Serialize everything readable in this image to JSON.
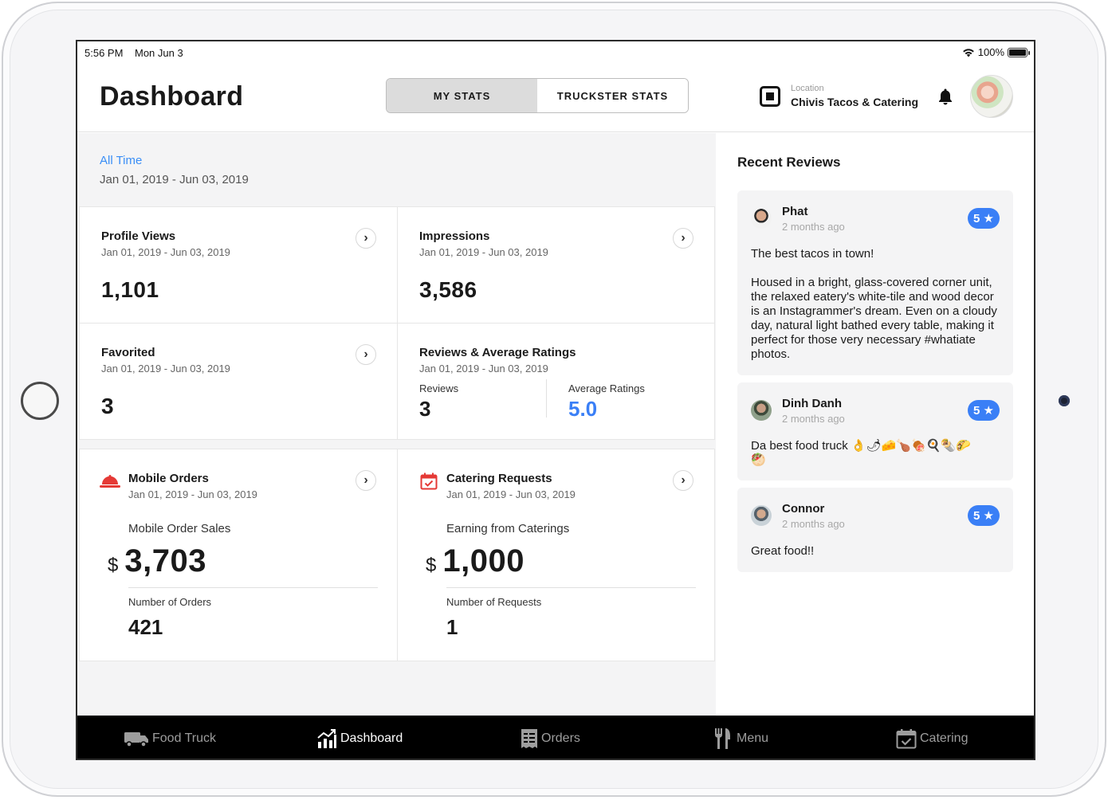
{
  "status": {
    "time": "5:56 PM",
    "date": "Mon Jun 3",
    "battery": "100%",
    "battery_level": 1.0
  },
  "header": {
    "title": "Dashboard",
    "tabs": [
      {
        "label": "MY STATS",
        "active": true
      },
      {
        "label": "TRUCKSTER STATS",
        "active": false
      }
    ],
    "location_label": "Location",
    "location_name": "Chivis Tacos & Catering"
  },
  "range": {
    "label": "All Time",
    "dates": "Jan 01, 2019 - Jun 03, 2019"
  },
  "cards": {
    "profile_views": {
      "title": "Profile Views",
      "dates": "Jan 01, 2019 - Jun 03, 2019",
      "value": "1,101"
    },
    "impressions": {
      "title": "Impressions",
      "dates": "Jan 01, 2019 - Jun 03, 2019",
      "value": "3,586"
    },
    "favorited": {
      "title": "Favorited",
      "dates": "Jan 01, 2019 - Jun 03, 2019",
      "value": "3"
    },
    "reviews": {
      "title": "Reviews & Average Ratings",
      "dates": "Jan 01, 2019 - Jun 03, 2019",
      "reviews_label": "Reviews",
      "reviews_value": "3",
      "avg_label": "Average Ratings",
      "avg_value": "5.0"
    },
    "mobile_orders": {
      "title": "Mobile Orders",
      "dates": "Jan 01, 2019 - Jun 03, 2019",
      "sales_label": "Mobile Order Sales",
      "currency": "$",
      "sales_value": "3,703",
      "count_label": "Number of Orders",
      "count_value": "421"
    },
    "catering": {
      "title": "Catering Requests",
      "dates": "Jan 01, 2019 - Jun 03, 2019",
      "sales_label": "Earning from Caterings",
      "currency": "$",
      "sales_value": "1,000",
      "count_label": "Number of Requests",
      "count_value": "1"
    }
  },
  "recent_reviews": {
    "title": "Recent Reviews",
    "items": [
      {
        "name": "Phat",
        "time": "2 months ago",
        "rating": "5 ★",
        "text": "The best tacos in town!\n\nHoused in a bright, glass-covered corner unit, the relaxed eatery's white-tile and wood decor is an Instagrammer's dream. Even on a cloudy day, natural light bathed every table, making it perfect for those very necessary #whatiate photos."
      },
      {
        "name": "Dinh Danh",
        "time": "2 months ago",
        "rating": "5 ★",
        "text": "Da best food truck 👌🌶🧀🍗🍖🍳🌯🌮\n🥙"
      },
      {
        "name": "Connor",
        "time": "2 months ago",
        "rating": "5 ★",
        "text": "Great food!!"
      }
    ]
  },
  "tabbar": [
    {
      "label": "Food Truck",
      "icon": "food-truck-icon",
      "active": false
    },
    {
      "label": "Dashboard",
      "icon": "chart-icon",
      "active": true
    },
    {
      "label": "Orders",
      "icon": "receipt-icon",
      "active": false
    },
    {
      "label": "Menu",
      "icon": "fork-knife-icon",
      "active": false
    },
    {
      "label": "Catering",
      "icon": "calendar-check-icon",
      "active": false
    }
  ],
  "colors": {
    "accent": "#3a7ff6",
    "alert_red": "#e53935",
    "tabbar_bg": "#000000"
  }
}
